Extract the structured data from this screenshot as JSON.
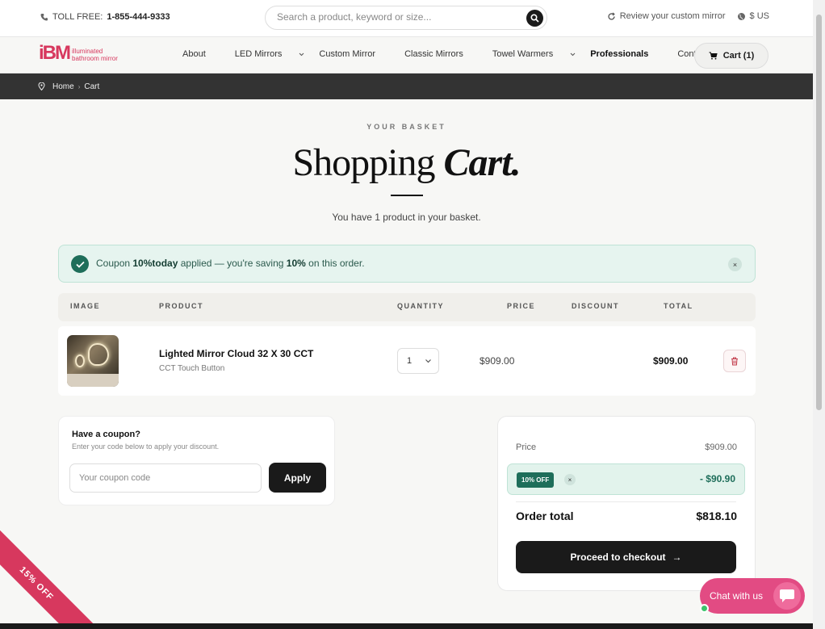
{
  "topbar": {
    "toll_free_label": "TOLL FREE:",
    "toll_free_number": "1-855-444-9333",
    "search_placeholder": "Search a product, keyword or size...",
    "review_label": "Review your custom mirror",
    "currency": "$ US"
  },
  "logo": {
    "mark": "iBM",
    "line1": "illuminated",
    "line2": "bathroom mirror"
  },
  "nav": {
    "items": [
      {
        "label": "About"
      },
      {
        "label": "LED Mirrors"
      },
      {
        "label": "Custom Mirror"
      },
      {
        "label": "Classic Mirrors"
      },
      {
        "label": "Towel Warmers"
      },
      {
        "label": "Professionals"
      },
      {
        "label": "Contact"
      }
    ],
    "cart_label": "Cart (1)"
  },
  "breadcrumb": {
    "home": "Home",
    "sep": "›",
    "current": "Cart"
  },
  "hero": {
    "eyebrow": "YOUR BASKET",
    "title_plain": "Shopping ",
    "title_em": "Cart.",
    "subtitle": "You have 1 product in your basket."
  },
  "alert": {
    "prefix": "Coupon ",
    "code": "10%today",
    "middle": " applied — you're saving ",
    "percent": "10%",
    "suffix": " on this order.",
    "close": "×"
  },
  "table": {
    "headers": [
      "IMAGE",
      "PRODUCT",
      "QUANTITY",
      "PRICE",
      "DISCOUNT",
      "TOTAL"
    ],
    "row": {
      "name": "Lighted Mirror Cloud 32 X 30 CCT",
      "variant": "CCT Touch Button",
      "quantity": "1",
      "price": "$909.00",
      "total": "$909.00"
    }
  },
  "coupon": {
    "heading": "Have a coupon?",
    "help": "Enter your code below to apply your discount.",
    "placeholder": "Your coupon code",
    "apply": "Apply"
  },
  "summary": {
    "price_label": "Price",
    "price_value": "$909.00",
    "discount_badge": "10% OFF",
    "discount_remove": "×",
    "discount_value": "- $90.90",
    "order_total_label": "Order total",
    "order_total_value": "$818.10",
    "checkout": "Proceed to checkout",
    "checkout_arrow": "→"
  },
  "promo": {
    "ribbon": "15% OFF"
  },
  "chat": {
    "label": "Chat with us"
  },
  "colors": {
    "brand": "#d7385e",
    "success": "#1e6e5a",
    "dark": "#1a1a1a",
    "chat": "#e24b83"
  }
}
